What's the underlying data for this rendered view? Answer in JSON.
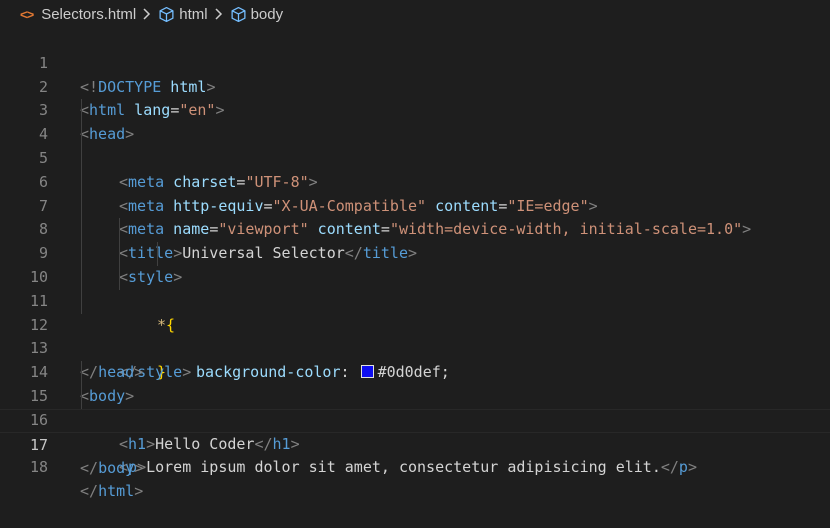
{
  "breadcrumb": {
    "file_icon": "<>",
    "file": "Selectors.html",
    "items": [
      "html",
      "body"
    ]
  },
  "colors": {
    "swatch": "#0d0def",
    "accent_icon": "#e37933"
  },
  "lines": [
    {
      "n": "1",
      "t": "<!DOCTYPE html>"
    },
    {
      "n": "2",
      "t": "<html lang=\"en\">"
    },
    {
      "n": "3",
      "t": "<head>"
    },
    {
      "n": "4",
      "t": "<meta charset=\"UTF-8\">"
    },
    {
      "n": "5",
      "t": "<meta http-equiv=\"X-UA-Compatible\" content=\"IE=edge\">"
    },
    {
      "n": "6",
      "t": "<meta name=\"viewport\" content=\"width=device-width, initial-scale=1.0\">"
    },
    {
      "n": "7",
      "t": "<title>Universal Selector</title>"
    },
    {
      "n": "8",
      "t": "<style>"
    },
    {
      "n": "9",
      "t": "*{"
    },
    {
      "n": "10",
      "t": "background-color: #0d0def;"
    },
    {
      "n": "11",
      "t": "}"
    },
    {
      "n": "12",
      "t": "</style>"
    },
    {
      "n": "13",
      "t": "</head>"
    },
    {
      "n": "14",
      "t": "<body>"
    },
    {
      "n": "15",
      "t": "<h1>Hello Coder</h1>"
    },
    {
      "n": "16",
      "t": "<p>Lorem ipsum dolor sit amet, consectetur adipisicing elit.</p>"
    },
    {
      "n": "17",
      "t": "</body>"
    },
    {
      "n": "18",
      "t": "</html>"
    }
  ],
  "tokens": {
    "l1": {
      "a": "<!",
      "b": "DOCTYPE",
      "c": " html",
      "d": ">"
    },
    "l2": {
      "a": "<",
      "b": "html",
      "c": " lang",
      "d": "=",
      "e": "\"en\"",
      "f": ">"
    },
    "l3": {
      "a": "<",
      "b": "head",
      "c": ">"
    },
    "l4": {
      "a": "<",
      "b": "meta",
      "c": " charset",
      "d": "=",
      "e": "\"UTF-8\"",
      "f": ">"
    },
    "l5": {
      "a": "<",
      "b": "meta",
      "c": " http-equiv",
      "d": "=",
      "e": "\"X-UA-Compatible\"",
      "f": " content",
      "g": "=",
      "h": "\"IE=edge\"",
      "i": ">"
    },
    "l6": {
      "a": "<",
      "b": "meta",
      "c": " name",
      "d": "=",
      "e": "\"viewport\"",
      "f": " content",
      "g": "=",
      "h": "\"width=device-width, initial-scale=1.0\"",
      "i": ">"
    },
    "l7": {
      "a": "<",
      "b": "title",
      "c": ">",
      "d": "Universal Selector",
      "e": "</",
      "f": "title",
      "g": ">"
    },
    "l8": {
      "a": "<",
      "b": "style",
      "c": ">"
    },
    "l9": {
      "a": "*",
      "b": "{"
    },
    "l10": {
      "a": "background-color",
      "b": ": ",
      "c": "#0d0def;"
    },
    "l11": {
      "a": "}"
    },
    "l12": {
      "a": "</",
      "b": "style",
      "c": ">"
    },
    "l13": {
      "a": "</",
      "b": "head",
      "c": ">"
    },
    "l14": {
      "a": "<",
      "b": "body",
      "c": ">"
    },
    "l15": {
      "a": "<",
      "b": "h1",
      "c": ">",
      "d": "Hello Coder",
      "e": "</",
      "f": "h1",
      "g": ">"
    },
    "l16": {
      "a": "<",
      "b": "p",
      "c": ">",
      "d": "Lorem ipsum dolor sit amet, consectetur adipisicing elit.",
      "e": "</",
      "f": "p",
      "g": ">"
    },
    "l17": {
      "a": "</",
      "b": "body",
      "c": ">"
    },
    "l18": {
      "a": "</",
      "b": "html",
      "c": ">"
    }
  }
}
